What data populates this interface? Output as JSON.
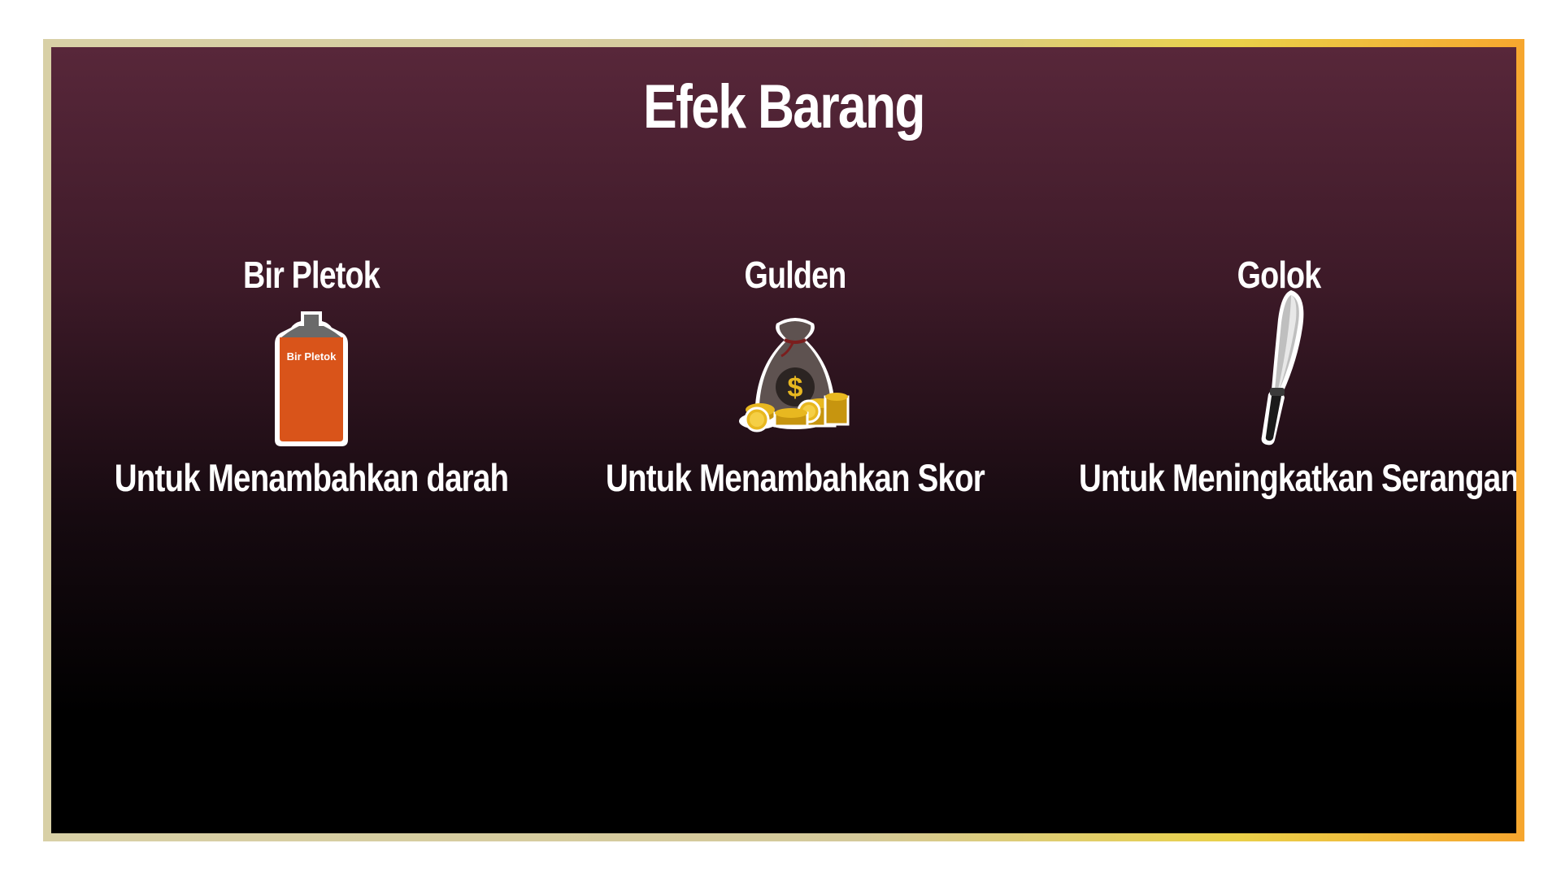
{
  "screen": {
    "title": "Efek Barang"
  },
  "items": [
    {
      "name": "Bir Pletok",
      "icon": "bottle-icon",
      "icon_label": "Bir Pletok",
      "description": "Untuk Menambahkan darah"
    },
    {
      "name": "Gulden",
      "icon": "money-bag-icon",
      "icon_label": "$",
      "description": "Untuk Menambahkan Skor"
    },
    {
      "name": "Golok",
      "icon": "machete-icon",
      "description": "Untuk Meningkatkan Serangan"
    }
  ],
  "colors": {
    "panel_top": "#58273a",
    "panel_bottom": "#000000",
    "frame": "#d4c99a",
    "frame_accent": "#f6a62e",
    "bottle": "#d9541a",
    "coin": "#e8b820",
    "bag": "#5e5250"
  }
}
